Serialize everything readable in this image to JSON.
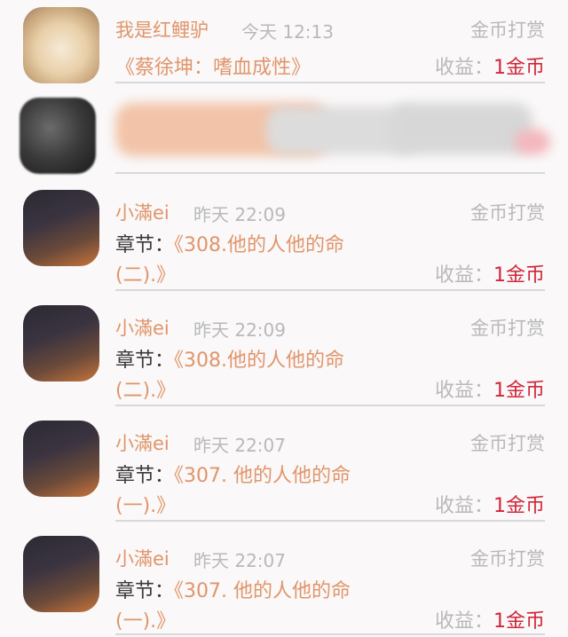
{
  "items": [
    {
      "name": "我是红鲤驴",
      "time": "今天 12:13",
      "reward_label": "金币打赏",
      "title": "《蔡徐坤：嗜血成性》",
      "income_label": "收益：",
      "income_amount": "1金币"
    },
    {
      "redacted": true
    },
    {
      "name": "小滿ei",
      "time": "昨天 22:09",
      "reward_label": "金币打赏",
      "chapter_prefix": "章节：",
      "chapter_line1": "《308.他的人他的命",
      "chapter_line2": "(二).》",
      "income_label": "收益：",
      "income_amount": "1金币"
    },
    {
      "name": "小滿ei",
      "time": "昨天 22:09",
      "reward_label": "金币打赏",
      "chapter_prefix": "章节：",
      "chapter_line1": "《308.他的人他的命",
      "chapter_line2": "(二).》",
      "income_label": "收益：",
      "income_amount": "1金币"
    },
    {
      "name": "小滿ei",
      "time": "昨天 22:07",
      "reward_label": "金币打赏",
      "chapter_prefix": "章节：",
      "chapter_line1": "《307. 他的人他的命",
      "chapter_line2": "(一).》",
      "income_label": "收益：",
      "income_amount": "1金币"
    },
    {
      "name": "小滿ei",
      "time": "昨天 22:07",
      "reward_label": "金币打赏",
      "chapter_prefix": "章节：",
      "chapter_line1": "《307. 他的人他的命",
      "chapter_line2": "(一).》",
      "income_label": "收益：",
      "income_amount": "1金币"
    }
  ],
  "colors": {
    "name": "#e0956b",
    "muted": "#b9b9b9",
    "amount": "#d0263a",
    "background": "#faf8f8"
  }
}
